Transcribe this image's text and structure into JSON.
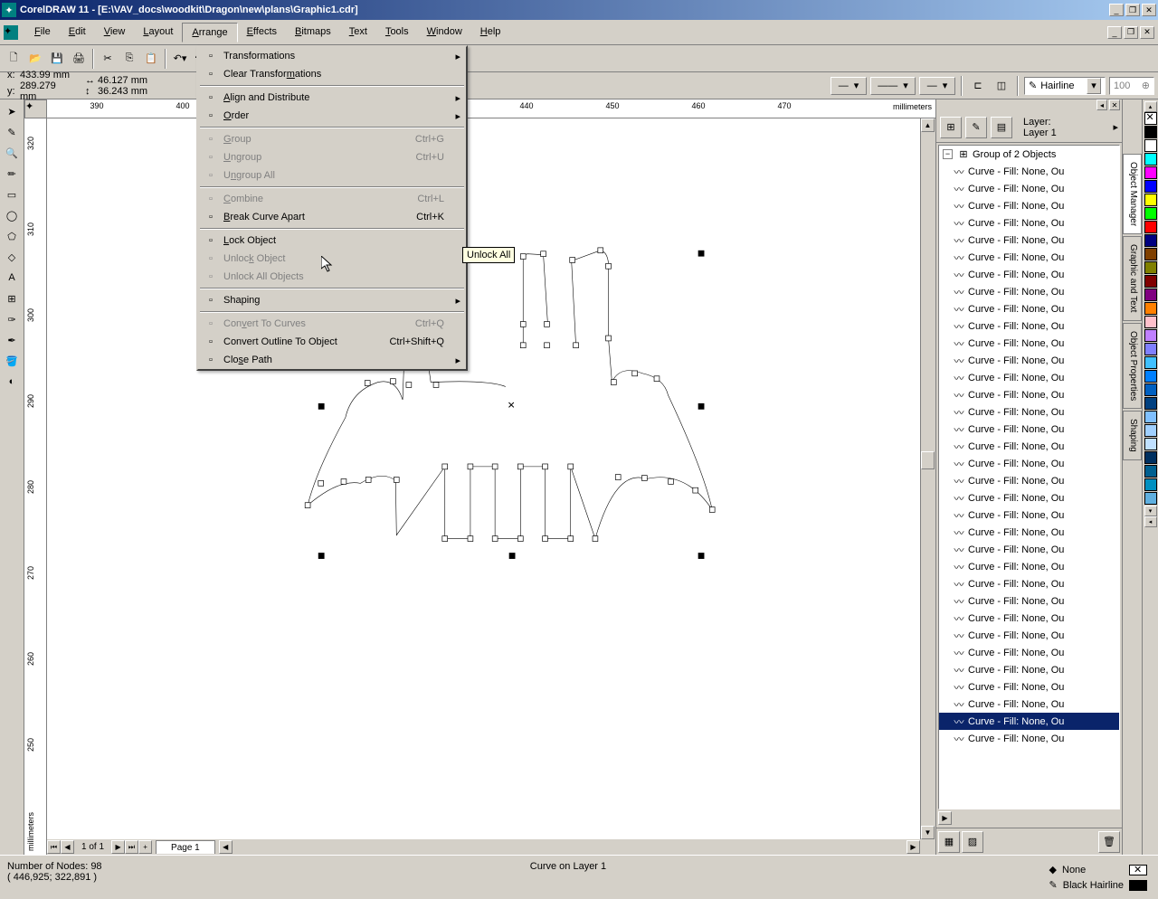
{
  "titlebar": {
    "text": "CorelDRAW 11 - [E:\\VAV_docs\\woodkit\\Dragon\\new\\plans\\Graphic1.cdr]"
  },
  "menubar": {
    "items": [
      "File",
      "Edit",
      "View",
      "Layout",
      "Arrange",
      "Effects",
      "Bitmaps",
      "Text",
      "Tools",
      "Window",
      "Help"
    ],
    "active_index": 4
  },
  "propbar": {
    "x": "433.99 mm",
    "y": "289.279 mm",
    "w": "46.127 mm",
    "h": "36.243 mm",
    "outline_style": "Hairline",
    "outline_size": "100"
  },
  "dropdown": {
    "items": [
      {
        "type": "item",
        "label": "Transformations",
        "submenu": true
      },
      {
        "type": "item",
        "label": "Clear Transformations",
        "underline": "m"
      },
      {
        "type": "sep"
      },
      {
        "type": "item",
        "label": "Align and Distribute",
        "submenu": true,
        "underline": "A"
      },
      {
        "type": "item",
        "label": "Order",
        "submenu": true,
        "underline": "O"
      },
      {
        "type": "sep"
      },
      {
        "type": "item",
        "label": "Group",
        "shortcut": "Ctrl+G",
        "disabled": true,
        "underline": "G"
      },
      {
        "type": "item",
        "label": "Ungroup",
        "shortcut": "Ctrl+U",
        "disabled": true,
        "underline": "U"
      },
      {
        "type": "item",
        "label": "Ungroup All",
        "disabled": true,
        "underline": "n"
      },
      {
        "type": "sep"
      },
      {
        "type": "item",
        "label": "Combine",
        "shortcut": "Ctrl+L",
        "disabled": true,
        "underline": "C"
      },
      {
        "type": "item",
        "label": "Break Curve Apart",
        "shortcut": "Ctrl+K",
        "underline": "B"
      },
      {
        "type": "sep"
      },
      {
        "type": "item",
        "label": "Lock Object",
        "underline": "L"
      },
      {
        "type": "item",
        "label": "Unlock Object",
        "disabled": true,
        "underline": "k"
      },
      {
        "type": "item",
        "label": "Unlock All Objects",
        "disabled": true,
        "underline": "j"
      },
      {
        "type": "sep"
      },
      {
        "type": "item",
        "label": "Shaping",
        "submenu": true,
        "underline": "P"
      },
      {
        "type": "sep"
      },
      {
        "type": "item",
        "label": "Convert To Curves",
        "shortcut": "Ctrl+Q",
        "disabled": true,
        "underline": "v"
      },
      {
        "type": "item",
        "label": "Convert Outline To Object",
        "shortcut": "Ctrl+Shift+Q",
        "underline": "E"
      },
      {
        "type": "item",
        "label": "Close Path",
        "submenu": true,
        "underline": "s"
      }
    ]
  },
  "tooltip": "Unlock All",
  "ruler": {
    "h_ticks": [
      390,
      400,
      440,
      450,
      460,
      470
    ],
    "h_unit": "millimeters",
    "v_ticks": [
      320,
      310,
      300,
      290,
      280,
      270,
      260,
      250
    ],
    "v_unit": "millimeters"
  },
  "nav": {
    "page_counter": "1 of 1",
    "page_tab": "Page 1"
  },
  "docker": {
    "layer_label": "Layer:",
    "layer_name": "Layer 1",
    "root": "Group of 2 Objects",
    "item_label": "Curve - Fill: None, Ou",
    "item_count": 34,
    "selected_index": 32,
    "tabs": [
      "Object Manager",
      "Graphic and Text",
      "Object Properties",
      "Shaping"
    ]
  },
  "colors": [
    "#000000",
    "#ffffff",
    "#00ffff",
    "#ff00ff",
    "#0000ff",
    "#ffff00",
    "#00ff00",
    "#ff0000",
    "#000080",
    "#804000",
    "#808000",
    "#800000",
    "#800080",
    "#ff8000",
    "#ffc0cb",
    "#c080ff",
    "#8080ff",
    "#40c0ff",
    "#0080ff",
    "#0060c0",
    "#004080",
    "#80c0ff",
    "#a0d0ff",
    "#c0e0ff",
    "#003060",
    "#006090",
    "#0090c0",
    "#60b0e0"
  ],
  "statusbar": {
    "nodes": "Number of Nodes: 98",
    "coords": "( 446,925; 322,891 )",
    "object": "Curve on Layer 1",
    "fill": "None",
    "outline": "Black Hairline"
  }
}
